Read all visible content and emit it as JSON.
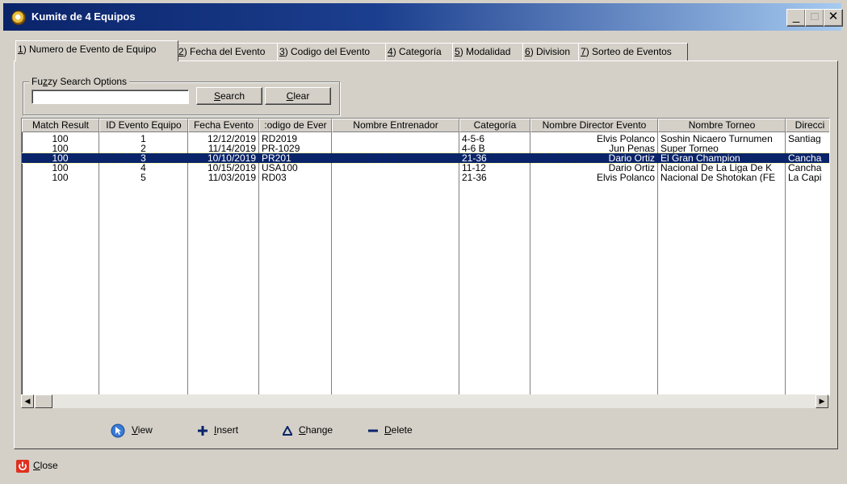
{
  "window": {
    "title": "Kumite de 4 Equipos",
    "controls": {
      "minimize": "_",
      "maximize": "□",
      "close": "✕"
    }
  },
  "tabs": [
    {
      "key": "1",
      "label": ") Numero de Evento de Equipo",
      "active": true
    },
    {
      "key": "2",
      "label": ") Fecha del Evento"
    },
    {
      "key": "3",
      "label": ") Codigo del Evento"
    },
    {
      "key": "4",
      "label": ") Categoría"
    },
    {
      "key": "5",
      "label": ") Modalidad"
    },
    {
      "key": "6",
      "label": ") Division"
    },
    {
      "key": "7",
      "label": ") Sorteo de Eventos"
    }
  ],
  "search": {
    "group_label_pre": "Fu",
    "group_label_key": "z",
    "group_label_post": "zy Search Options",
    "value": "",
    "search_key": "S",
    "search_rest": "earch",
    "clear_key": "C",
    "clear_rest": "lear"
  },
  "grid": {
    "columns": [
      "Match Result",
      "ID Evento Equipo",
      "Fecha Evento",
      ":odigo de Ever",
      "Nombre Entrenador",
      "Categoría",
      "Nombre Director Evento",
      "Nombre Torneo",
      "Direcci"
    ],
    "rows": [
      [
        "100",
        "1",
        "12/12/2019",
        "RD2019",
        "",
        "4-5-6",
        "Elvis Polanco",
        "Soshin Nicaero Turnumen",
        "Santiag"
      ],
      [
        "100",
        "2",
        "11/14/2019",
        "PR-1029",
        "",
        "4-6 B",
        "Jun Penas",
        "Super Torneo",
        ""
      ],
      [
        "100",
        "3",
        "10/10/2019",
        "PR201",
        "",
        "21-36",
        "Dario Ortiz",
        "El Gran Champion",
        "Cancha"
      ],
      [
        "100",
        "4",
        "10/15/2019",
        "USA100",
        "",
        "11-12",
        "Dario Ortiz",
        "Nacional De La Liga De K",
        "Cancha"
      ],
      [
        "100",
        "5",
        "11/03/2019",
        "RD03",
        "",
        "21-36",
        "Elvis Polanco",
        "Nacional De Shotokan (FE",
        "La Capi"
      ]
    ],
    "selected_row": 2
  },
  "scrollbar": {
    "left_arrow": "◀",
    "right_arrow": "▶"
  },
  "actions": {
    "view_key": "V",
    "view_rest": "iew",
    "insert_key": "I",
    "insert_rest": "nsert",
    "change_key": "C",
    "change_rest": "hange",
    "delete_key": "D",
    "delete_rest": "elete"
  },
  "close": {
    "key": "C",
    "rest": "lose"
  },
  "colors": {
    "titlebar_start": "#0a246a",
    "titlebar_end": "#a6caf0",
    "selection": "#0a246a",
    "face": "#d4d0c8"
  }
}
